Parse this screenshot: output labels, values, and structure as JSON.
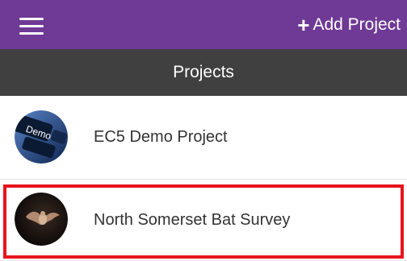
{
  "header": {
    "add_project_label": "Add Project",
    "add_icon": "plus-icon",
    "menu_icon": "hamburger-menu-icon",
    "accent_color": "#6f3a95"
  },
  "title_bar": {
    "title": "Projects",
    "background": "#404040"
  },
  "projects": [
    {
      "name": "EC5 Demo Project",
      "logo_text": "Demo",
      "icon": "demo-keyboard-logo"
    },
    {
      "name": "North Somerset Bat Survey",
      "icon": "bat-logo",
      "highlighted": true
    }
  ],
  "highlight_color": "#e8141e"
}
